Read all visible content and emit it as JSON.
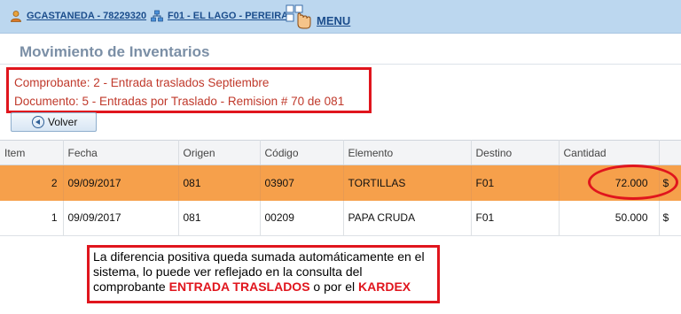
{
  "topbar": {
    "user": "GCASTANEDA - 78229320",
    "branch": "F01 - EL LAGO - PEREIRA",
    "menu": "MENU"
  },
  "page": {
    "title": "Movimiento de Inventarios"
  },
  "info": {
    "comprobante": "Comprobante: 2 - Entrada traslados Septiembre",
    "documento": "Documento: 5 - Entradas por Traslado - Remision # 70 de 081"
  },
  "buttons": {
    "volver": "Volver"
  },
  "table": {
    "headers": [
      "Item",
      "Fecha",
      "Origen",
      "Código",
      "Elemento",
      "Destino",
      "Cantidad"
    ],
    "rows": [
      {
        "item": "2",
        "fecha": "09/09/2017",
        "origen": "081",
        "codigo": "03907",
        "elemento": "TORTILLAS",
        "destino": "F01",
        "cantidad": "72.000",
        "moneda": "$"
      },
      {
        "item": "1",
        "fecha": "09/09/2017",
        "origen": "081",
        "codigo": "00209",
        "elemento": "PAPA CRUDA",
        "destino": "F01",
        "cantidad": "50.000",
        "moneda": "$"
      }
    ]
  },
  "note": {
    "part1": "La diferencia positiva queda sumada automáticamente en el sistema, lo puede ver reflejado en la consulta del comprobante ",
    "hl1": "ENTRADA TRASLADOS",
    "part2": " o por el ",
    "hl2": "KARDEX"
  },
  "colors": {
    "accent": "#e0151d",
    "selected_row": "#f6a04b",
    "topbar": "#bcd7ef"
  },
  "icons": {
    "user": "user-icon",
    "branch": "network-icon",
    "menu": "menu-hand-icon",
    "back": "back-arrow-icon"
  }
}
